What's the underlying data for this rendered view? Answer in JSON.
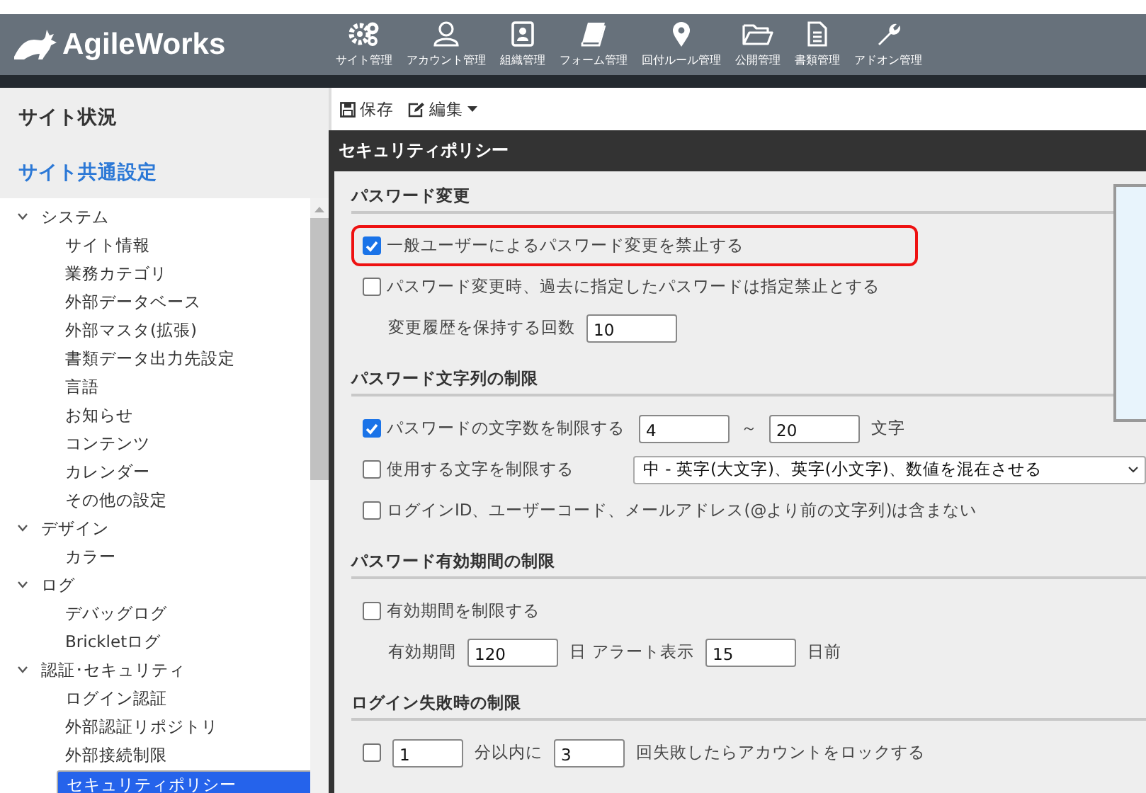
{
  "header": {
    "logo": "AgileWorks",
    "nav": [
      {
        "label": "サイト管理"
      },
      {
        "label": "アカウント管理"
      },
      {
        "label": "組織管理"
      },
      {
        "label": "フォーム管理"
      },
      {
        "label": "回付ルール管理"
      },
      {
        "label": "公開管理"
      },
      {
        "label": "書類管理"
      },
      {
        "label": "アドオン管理"
      }
    ]
  },
  "sidebar": {
    "status": "サイト状況",
    "common": "サイト共通設定",
    "tree": [
      {
        "label": "システム",
        "expanded": true,
        "children": [
          {
            "label": "サイト情報",
            "selected": false
          },
          {
            "label": "業務カテゴリ",
            "selected": false
          },
          {
            "label": "外部データベース",
            "selected": false
          },
          {
            "label": "外部マスタ(拡張)",
            "selected": false
          },
          {
            "label": "書類データ出力先設定",
            "selected": false
          },
          {
            "label": "言語",
            "selected": false
          },
          {
            "label": "お知らせ",
            "selected": false
          },
          {
            "label": "コンテンツ",
            "selected": false
          },
          {
            "label": "カレンダー",
            "selected": false
          },
          {
            "label": "その他の設定",
            "selected": false
          }
        ]
      },
      {
        "label": "デザイン",
        "expanded": true,
        "children": [
          {
            "label": "カラー",
            "selected": false
          }
        ]
      },
      {
        "label": "ログ",
        "expanded": true,
        "children": [
          {
            "label": "デバッグログ",
            "selected": false
          },
          {
            "label": "Brickletログ",
            "selected": false
          }
        ]
      },
      {
        "label": "認証･セキュリティ",
        "expanded": true,
        "children": [
          {
            "label": "ログイン認証",
            "selected": false
          },
          {
            "label": "外部認証リポジトリ",
            "selected": false
          },
          {
            "label": "外部接続制限",
            "selected": false
          },
          {
            "label": "セキュリティポリシー",
            "selected": true
          }
        ]
      }
    ]
  },
  "toolbar": {
    "save": "保存",
    "edit": "編集"
  },
  "panel": {
    "title": "セキュリティポリシー",
    "sections": [
      {
        "title": "パスワード変更",
        "rows": [
          {
            "highlighted": true,
            "indented": false,
            "parts": [
              {
                "kind": "checkbox",
                "checked": true
              },
              {
                "kind": "text",
                "text": "一般ユーザーによるパスワード変更を禁止する"
              }
            ]
          },
          {
            "highlighted": false,
            "indented": false,
            "parts": [
              {
                "kind": "checkbox",
                "checked": false
              },
              {
                "kind": "text",
                "text": "パスワード変更時、過去に指定したパスワードは指定禁止とする"
              }
            ]
          },
          {
            "highlighted": false,
            "indented": true,
            "parts": [
              {
                "kind": "text",
                "text": "変更履歴を保持する回数"
              },
              {
                "kind": "input",
                "value": "10"
              }
            ]
          }
        ]
      },
      {
        "title": "パスワード文字列の制限",
        "rows": [
          {
            "highlighted": false,
            "indented": false,
            "parts": [
              {
                "kind": "checkbox",
                "checked": true
              },
              {
                "kind": "label",
                "text": "パスワードの文字数を制限する"
              },
              {
                "kind": "input",
                "value": "4"
              },
              {
                "kind": "text",
                "text": "～"
              },
              {
                "kind": "input",
                "value": "20"
              },
              {
                "kind": "text",
                "text": "文字"
              }
            ]
          },
          {
            "highlighted": false,
            "indented": false,
            "parts": [
              {
                "kind": "checkbox",
                "checked": false
              },
              {
                "kind": "label",
                "text": "使用する文字を制限する"
              },
              {
                "kind": "select",
                "value": "中 - 英字(大文字)、英字(小文字)、数値を混在させる"
              }
            ]
          },
          {
            "highlighted": false,
            "indented": false,
            "parts": [
              {
                "kind": "checkbox",
                "checked": false
              },
              {
                "kind": "text",
                "text": "ログインID、ユーザーコード、メールアドレス(@より前の文字列)は含まない"
              }
            ]
          }
        ]
      },
      {
        "title": "パスワード有効期間の制限",
        "rows": [
          {
            "highlighted": false,
            "indented": false,
            "parts": [
              {
                "kind": "checkbox",
                "checked": false
              },
              {
                "kind": "text",
                "text": "有効期間を制限する"
              }
            ]
          },
          {
            "highlighted": false,
            "indented": true,
            "parts": [
              {
                "kind": "text",
                "text": "有効期間"
              },
              {
                "kind": "input",
                "value": "120"
              },
              {
                "kind": "text",
                "text": "日"
              },
              {
                "kind": "text",
                "text": "アラート表示"
              },
              {
                "kind": "input",
                "value": "15"
              },
              {
                "kind": "text",
                "text": "日前"
              }
            ]
          }
        ]
      },
      {
        "title": "ログイン失敗時の制限",
        "rows": [
          {
            "highlighted": false,
            "indented": false,
            "parts": [
              {
                "kind": "checkbox",
                "checked": false
              },
              {
                "kind": "input",
                "value": "1"
              },
              {
                "kind": "text",
                "text": "分以内に"
              },
              {
                "kind": "input",
                "value": "3"
              },
              {
                "kind": "text",
                "text": "回失敗したらアカウントをロックする"
              }
            ]
          }
        ]
      }
    ]
  }
}
